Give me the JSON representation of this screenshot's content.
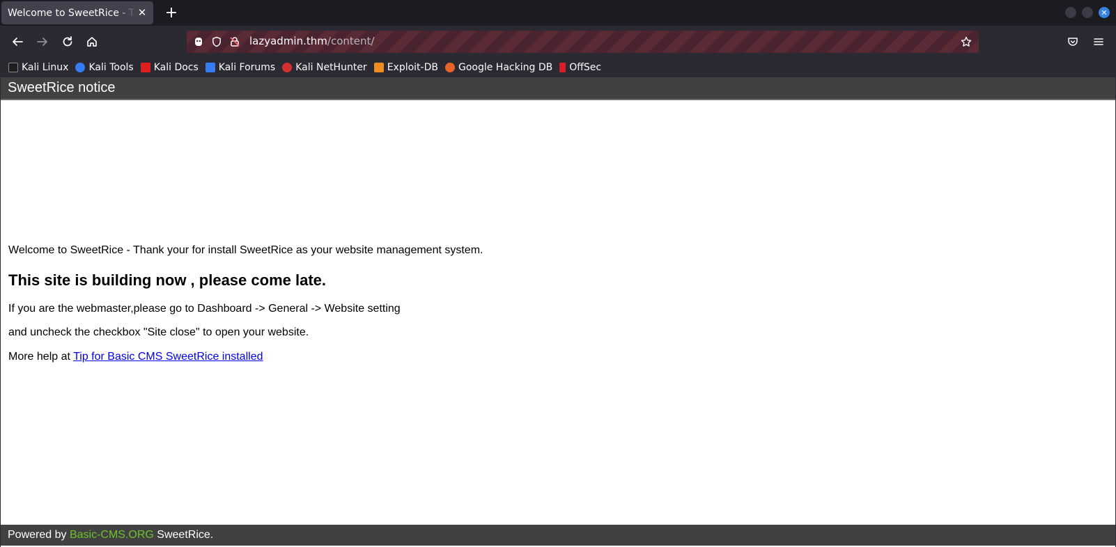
{
  "browser": {
    "tab_title": "Welcome to SweetRice - Thank your for install SweetRice as your website management system.",
    "url_host": "lazyadmin.thm",
    "url_path": "/content/",
    "bookmarks": [
      {
        "label": "Kali Linux",
        "color": "#1f1f1f"
      },
      {
        "label": "Kali Tools",
        "color": "#367bf0"
      },
      {
        "label": "Kali Docs",
        "color": "#e02020"
      },
      {
        "label": "Kali Forums",
        "color": "#367bf0"
      },
      {
        "label": "Kali NetHunter",
        "color": "#d32f2f"
      },
      {
        "label": "Exploit-DB",
        "color": "#f08c20"
      },
      {
        "label": "Google Hacking DB",
        "color": "#e8632a"
      },
      {
        "label": "OffSec",
        "color": "#d61f2a"
      }
    ]
  },
  "page": {
    "header": "SweetRice notice",
    "welcome": "Welcome to SweetRice - Thank your for install SweetRice as your website management system.",
    "heading": "This site is building now , please come late.",
    "line1": "If you are the webmaster,please go to Dashboard -> General -> Website setting",
    "line2": "and uncheck the checkbox \"Site close\" to open your website.",
    "help_prefix": "More help at ",
    "help_link": "Tip for Basic CMS SweetRice installed",
    "footer_prefix": "Powered by ",
    "footer_link": "Basic-CMS.ORG",
    "footer_suffix": " SweetRice."
  }
}
